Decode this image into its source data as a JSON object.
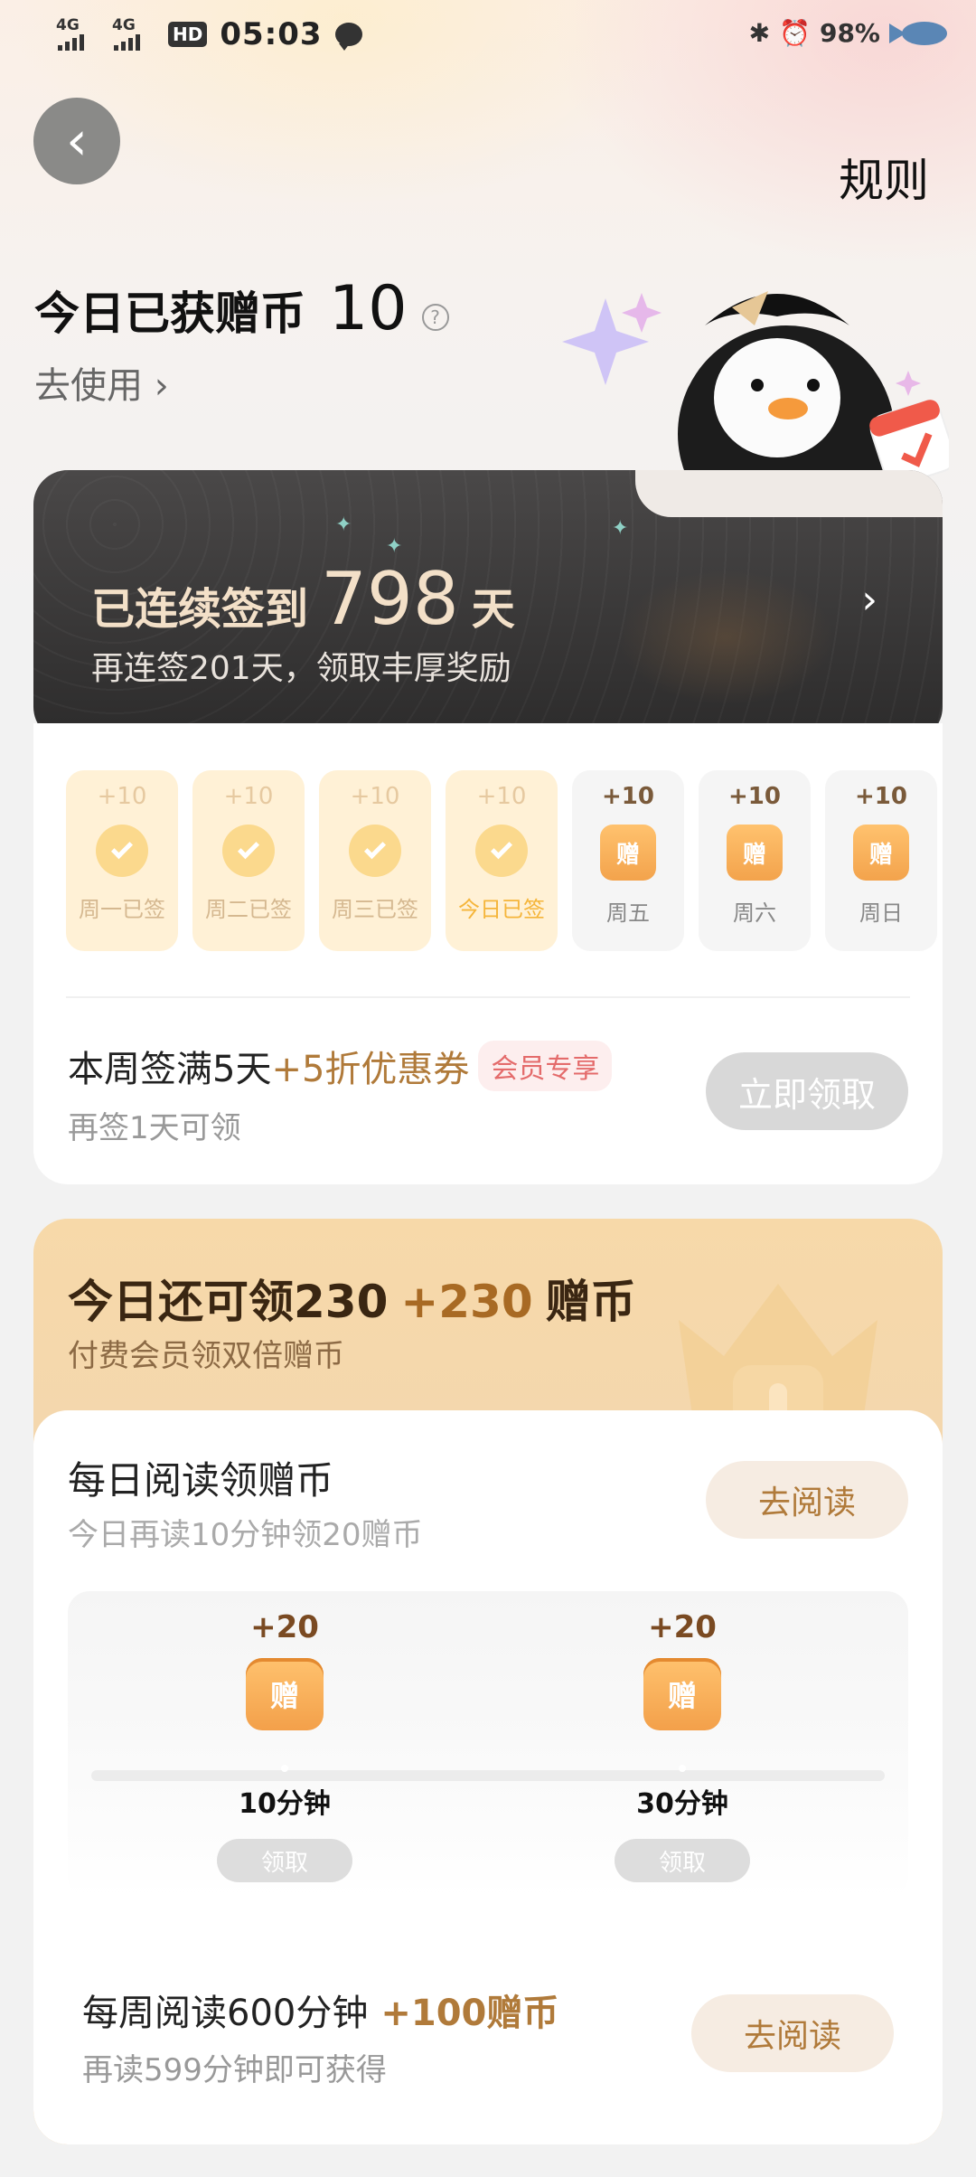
{
  "status_bar": {
    "signal1": "4G",
    "signal2": "4G",
    "hd": "HD",
    "time": "05:03",
    "battery": "98%",
    "bluetooth_icon": "bluetooth-icon",
    "alarm_icon": "alarm-icon"
  },
  "header": {
    "rules": "规则"
  },
  "coins": {
    "title": "今日已获赠币",
    "value": "10",
    "go_use": "去使用 ›"
  },
  "streak": {
    "prefix": "已连续签到",
    "days": "798",
    "suffix": "天",
    "subtitle": "再连签201天，领取丰厚奖励",
    "chevron": "›"
  },
  "week": {
    "days": [
      {
        "plus": "+10",
        "label": "周一已签",
        "state": "signed"
      },
      {
        "plus": "+10",
        "label": "周二已签",
        "state": "signed"
      },
      {
        "plus": "+10",
        "label": "周三已签",
        "state": "signed"
      },
      {
        "plus": "+10",
        "label": "今日已签",
        "state": "today"
      },
      {
        "plus": "+10",
        "label": "周五",
        "state": "pending"
      },
      {
        "plus": "+10",
        "label": "周六",
        "state": "pending"
      },
      {
        "plus": "+10",
        "label": "周日",
        "state": "pending"
      }
    ],
    "gift_glyph": "赠",
    "coupon_title_a": "本周签满5天",
    "coupon_title_b": "+5折优惠券",
    "vip_tag": "会员专享",
    "coupon_sub": "再签1天可领",
    "claim_button": "立即领取"
  },
  "daily": {
    "title_a": "今日还可领230",
    "title_b": "+230",
    "title_c": "赠币",
    "subtitle": "付费会员领双倍赠币",
    "task_title": "每日阅读领赠币",
    "task_sub": "今日再读10分钟领20赠币",
    "go_read": "去阅读",
    "nodes": [
      {
        "plus": "+20",
        "time": "10分钟",
        "button": "领取"
      },
      {
        "plus": "+20",
        "time": "30分钟",
        "button": "领取"
      }
    ],
    "gift_glyph": "赠",
    "weekly_title_a": "每周阅读600分钟",
    "weekly_title_b": "+100赠币",
    "weekly_sub": "再读599分钟即可获得",
    "go_read_2": "去阅读"
  }
}
